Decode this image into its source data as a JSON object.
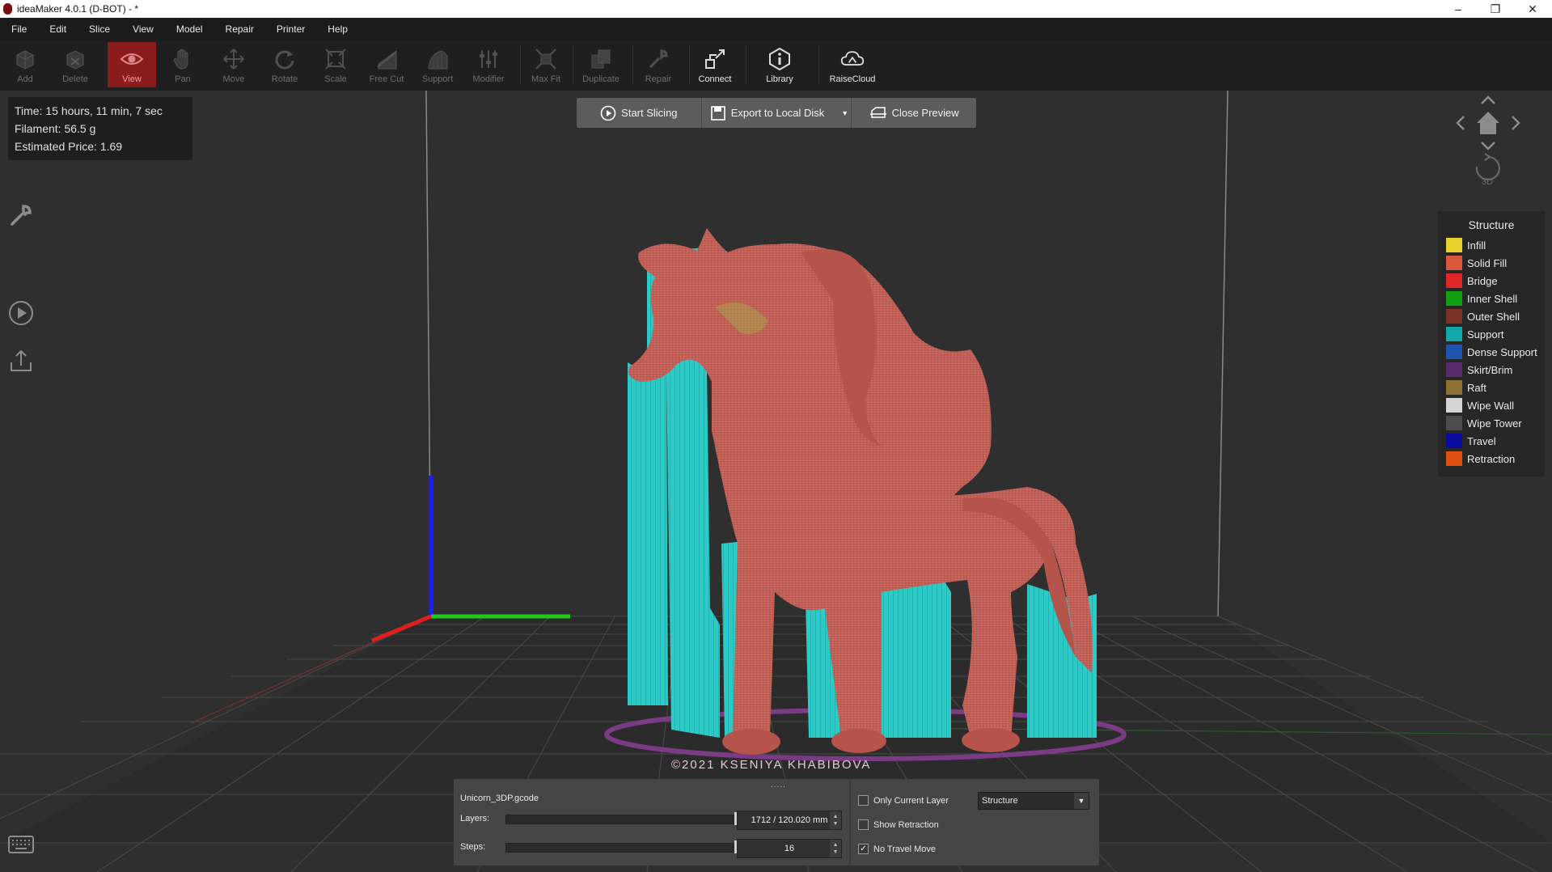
{
  "window": {
    "title": "ideaMaker 4.0.1 (D-BOT) - *",
    "controls": [
      "–",
      "❐",
      "✕"
    ]
  },
  "menu": [
    "File",
    "Edit",
    "Slice",
    "View",
    "Model",
    "Repair",
    "Printer",
    "Help"
  ],
  "toolbar": {
    "tools": [
      {
        "label": "Add",
        "icon": "add-icon",
        "state": "disabled"
      },
      {
        "label": "Delete",
        "icon": "delete-icon",
        "state": "disabled"
      },
      {
        "label": "View",
        "icon": "eye-icon",
        "state": "active"
      },
      {
        "label": "Pan",
        "icon": "hand-icon",
        "state": "disabled"
      },
      {
        "label": "Move",
        "icon": "move-icon",
        "state": "disabled"
      },
      {
        "label": "Rotate",
        "icon": "rotate-icon",
        "state": "disabled"
      },
      {
        "label": "Scale",
        "icon": "scale-icon",
        "state": "disabled"
      },
      {
        "label": "Free Cut",
        "icon": "cut-icon",
        "state": "disabled"
      },
      {
        "label": "Support",
        "icon": "support-icon",
        "state": "disabled"
      },
      {
        "label": "Modifier",
        "icon": "modifier-icon",
        "state": "disabled"
      },
      {
        "label": "Max Fit",
        "icon": "max-fit-icon",
        "state": "disabled"
      },
      {
        "label": "Duplicate",
        "icon": "duplicate-icon",
        "state": "disabled"
      },
      {
        "label": "Repair",
        "icon": "repair-icon",
        "state": "disabled"
      },
      {
        "label": "Connect",
        "icon": "connect-icon",
        "state": "enabled"
      },
      {
        "label": "Library",
        "icon": "library-icon",
        "state": "enabled"
      },
      {
        "label": "RaiseCloud",
        "icon": "cloud-icon",
        "state": "enabled"
      }
    ],
    "active_color": "#8c1c1c"
  },
  "stats": {
    "time": "Time: 15 hours, 11 min, 7 sec",
    "filament": "Filament: 56.5 g",
    "price": "Estimated Price: 1.69"
  },
  "slice_bar": {
    "start": "Start Slicing",
    "export": "Export to Local Disk",
    "close": "Close Preview"
  },
  "nav": {
    "view_3d": "3D"
  },
  "legend": {
    "title": "Structure",
    "items": [
      {
        "label": "Infill",
        "color": "#e8d22c"
      },
      {
        "label": "Solid Fill",
        "color": "#d8593a"
      },
      {
        "label": "Bridge",
        "color": "#e02626"
      },
      {
        "label": "Inner Shell",
        "color": "#12a012"
      },
      {
        "label": "Outer Shell",
        "color": "#7a3226"
      },
      {
        "label": "Support",
        "color": "#13a8a8"
      },
      {
        "label": "Dense Support",
        "color": "#1c54b0"
      },
      {
        "label": "Skirt/Brim",
        "color": "#5a2a6e"
      },
      {
        "label": "Raft",
        "color": "#8e7032"
      },
      {
        "label": "Wipe Wall",
        "color": "#d4d4d4"
      },
      {
        "label": "Wipe Tower",
        "color": "#4c4c4c"
      },
      {
        "label": "Travel",
        "color": "#0a0a9e"
      },
      {
        "label": "Retraction",
        "color": "#e05010"
      }
    ]
  },
  "model_colors": {
    "body": "#c4625a",
    "support": "#2cc9c6"
  },
  "watermark": "©2021 KSENIYA KHABIBOVA",
  "bottom_panel": {
    "grip": ".....",
    "filename": "Unicorn_3DP.gcode",
    "layers_label": "Layers:",
    "layers_value": "1712 / 120.020 mm",
    "layers_fraction": 1.0,
    "steps_label": "Steps:",
    "steps_value": "16",
    "steps_fraction": 1.0,
    "only_current_layer": {
      "label": "Only Current Layer",
      "checked": false
    },
    "show_retraction": {
      "label": "Show Retraction",
      "checked": false
    },
    "no_travel_move": {
      "label": "No Travel Move",
      "checked": true
    },
    "view_mode": "Structure"
  }
}
